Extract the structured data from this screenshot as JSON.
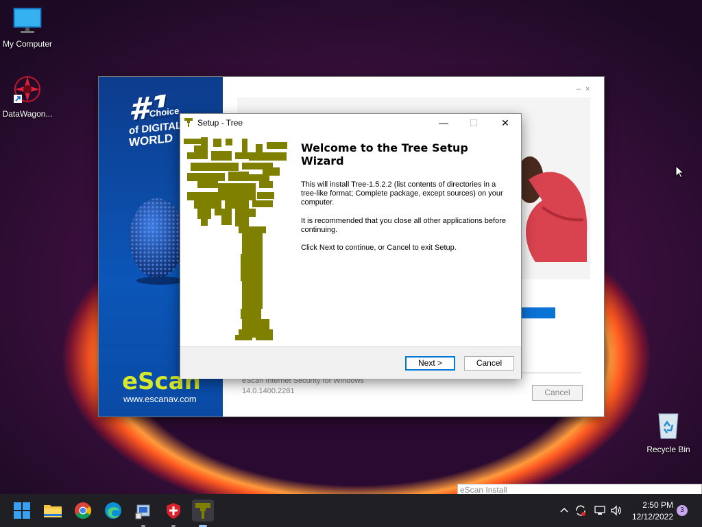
{
  "desktop": {
    "icons": [
      {
        "label": "My Computer"
      },
      {
        "label": "DataWagon..."
      },
      {
        "label": "Recycle Bin"
      }
    ]
  },
  "escan_window": {
    "brand": "eScan",
    "site": "www.escanav.com",
    "badge_top": "#1",
    "badge_choice": "Choice",
    "badge_of": "of DIGITAL",
    "badge_world": "WORLD",
    "product_line1": "eScan Internet Security for Windows",
    "product_line2": "14.0.1400.2281",
    "cancel_label": "Cancel",
    "min_glyph": "–",
    "close_glyph": "×"
  },
  "setup_dialog": {
    "title": "Setup - Tree",
    "heading": "Welcome to the Tree Setup Wizard",
    "para1": "This will install Tree-1.5.2.2 (list contents of directories in a tree-like format; Complete package, except sources) on your computer.",
    "para2": "It is recommended that you close all other applications before continuing.",
    "para3": "Click Next to continue, or Cancel to exit Setup.",
    "next_label": "Next >",
    "cancel_label": "Cancel",
    "min_glyph": "—",
    "max_glyph": "☐",
    "close_glyph": "✕",
    "tree_color": "#808000"
  },
  "tooltip": {
    "text": "eScan Install"
  },
  "taskbar": {
    "apps": [
      {
        "name": "start"
      },
      {
        "name": "file-explorer"
      },
      {
        "name": "chrome"
      },
      {
        "name": "edge"
      },
      {
        "name": "installer"
      },
      {
        "name": "escan"
      },
      {
        "name": "tree-setup"
      }
    ],
    "time": "2:50 PM",
    "date": "12/12/2022",
    "notifications": "3"
  }
}
